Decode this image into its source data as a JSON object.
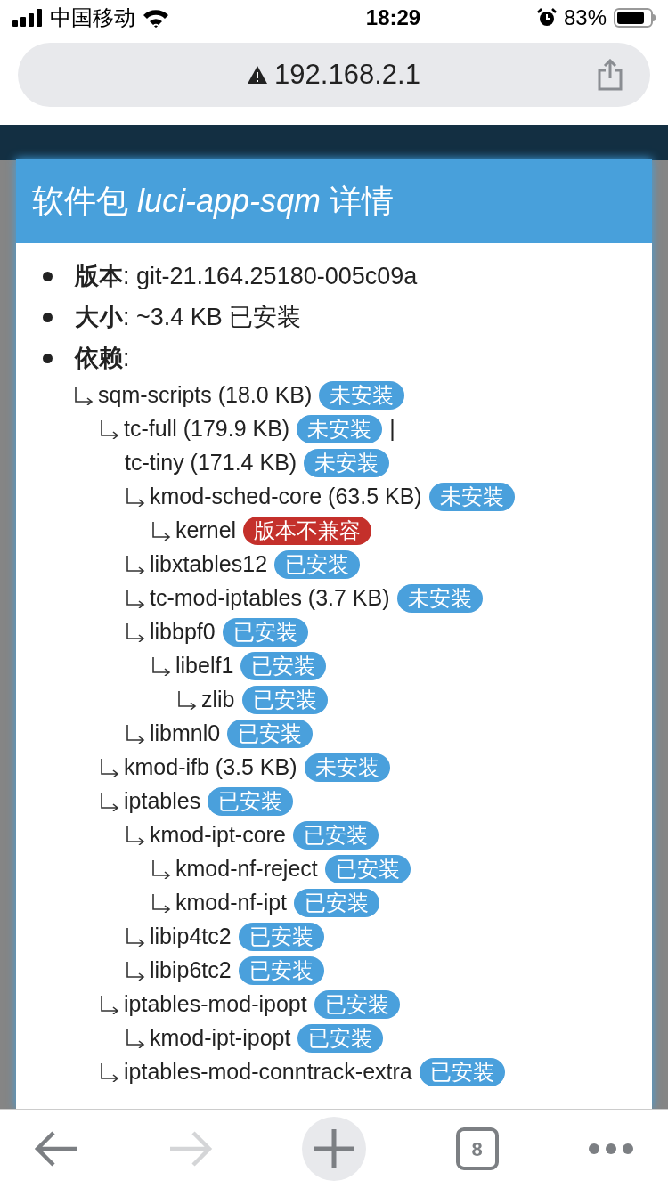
{
  "status_bar": {
    "carrier": "中国移动",
    "time": "18:29",
    "battery": "83%"
  },
  "address_bar": {
    "url": "192.168.2.1",
    "insecure": true
  },
  "dialog": {
    "title": "软件包 *luci-app-sqm* 详情",
    "info": [
      {
        "text": "**版本**: git-21.164.25180-005c09a"
      },
      {
        "text": "**大小**: ~3.4 KB 已安装"
      },
      {
        "text": "**依赖**:"
      }
    ],
    "dependencies": [
      {
        "name": "sqm-scripts (18.0 KB)",
        "badge": {
          "text": "未安装",
          "kind": "info"
        },
        "children": [
          {
            "name": "tc-full (179.9 KB)",
            "badge": {
              "text": "未安装",
              "kind": "info"
            },
            "separator": "|",
            "alternatives": [
              {
                "name": "tc-tiny (171.4 KB)",
                "badge": {
                  "text": "未安装",
                  "kind": "info"
                }
              }
            ],
            "children": [
              {
                "name": "kmod-sched-core (63.5 KB)",
                "badge": {
                  "text": "未安装",
                  "kind": "info"
                },
                "children": [
                  {
                    "name": "kernel",
                    "badge": {
                      "text": "版本不兼容",
                      "kind": "error"
                    }
                  }
                ]
              },
              {
                "name": "libxtables12",
                "badge": {
                  "text": "已安装",
                  "kind": "info"
                }
              },
              {
                "name": "tc-mod-iptables (3.7 KB)",
                "badge": {
                  "text": "未安装",
                  "kind": "info"
                }
              },
              {
                "name": "libbpf0",
                "badge": {
                  "text": "已安装",
                  "kind": "info"
                },
                "children": [
                  {
                    "name": "libelf1",
                    "badge": {
                      "text": "已安装",
                      "kind": "info"
                    },
                    "children": [
                      {
                        "name": "zlib",
                        "badge": {
                          "text": "已安装",
                          "kind": "info"
                        }
                      }
                    ]
                  }
                ]
              },
              {
                "name": "libmnl0",
                "badge": {
                  "text": "已安装",
                  "kind": "info"
                }
              }
            ]
          },
          {
            "name": "kmod-ifb (3.5 KB)",
            "badge": {
              "text": "未安装",
              "kind": "info"
            }
          },
          {
            "name": "iptables",
            "badge": {
              "text": "已安装",
              "kind": "info"
            },
            "children": [
              {
                "name": "kmod-ipt-core",
                "badge": {
                  "text": "已安装",
                  "kind": "info"
                },
                "children": [
                  {
                    "name": "kmod-nf-reject",
                    "badge": {
                      "text": "已安装",
                      "kind": "info"
                    }
                  },
                  {
                    "name": "kmod-nf-ipt",
                    "badge": {
                      "text": "已安装",
                      "kind": "info"
                    }
                  }
                ]
              },
              {
                "name": "libip4tc2",
                "badge": {
                  "text": "已安装",
                  "kind": "info"
                }
              },
              {
                "name": "libip6tc2",
                "badge": {
                  "text": "已安装",
                  "kind": "info"
                }
              }
            ]
          },
          {
            "name": "iptables-mod-ipopt",
            "badge": {
              "text": "已安装",
              "kind": "info"
            },
            "children": [
              {
                "name": "kmod-ipt-ipopt",
                "badge": {
                  "text": "已安装",
                  "kind": "info"
                }
              }
            ]
          },
          {
            "name": "iptables-mod-conntrack-extra",
            "badge": {
              "text": "已安装",
              "kind": "info"
            }
          }
        ]
      }
    ]
  },
  "toolbar": {
    "forward_disabled": true,
    "tab_count": "8"
  }
}
